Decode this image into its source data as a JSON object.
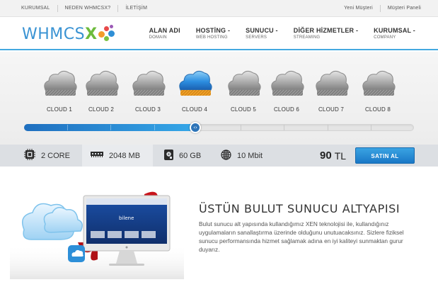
{
  "topbar": {
    "left_links": [
      "KURUMSAL",
      "NEDEN WHMCSX?",
      "İLETİŞİM"
    ],
    "right_links": [
      "Yeni Müşteri",
      "Müşteri Paneli"
    ]
  },
  "header": {
    "logo_text": "WHMCS",
    "logo_x": "X",
    "nav": [
      {
        "label": "ALAN ADI",
        "sub": "DOMAIN"
      },
      {
        "label": "HOSTİNG",
        "sub": "WEB HOSTING"
      },
      {
        "label": "SUNUCU",
        "sub": "SERVERS"
      },
      {
        "label": "DİĞER HİZMETLER",
        "sub": "STREAMING"
      },
      {
        "label": "KURUMSAL",
        "sub": "COMPANY"
      }
    ],
    "dropdown_marker": "-"
  },
  "plans": {
    "items": [
      "CLOUD 1",
      "CLOUD 2",
      "CLOUD 3",
      "CLOUD 4",
      "CLOUD 5",
      "CLOUD 6",
      "CLOUD 7",
      "CLOUD 8"
    ],
    "selected_index": 3,
    "slider_fraction": 0.44,
    "handle_glyph": "‹›"
  },
  "specs": {
    "cpu": "2 CORE",
    "ram": "2048 MB",
    "disk": "60 GB",
    "bandwidth": "10 Mbit",
    "price_value": "90",
    "price_currency": "TL",
    "buy_label": "SATIN AL"
  },
  "feature": {
    "title": "ÜSTÜN BULUT SUNUCU ALTYAPISI",
    "text": "Bulut sunucu alt yapısında kullandığımız XEN teknolojisi ile, kullandığınız uygulamaların sanallaştırma üzerinde olduğunu unutuacaksınız. Sizlere fiziksel sunucu performansında hizmet sağlamak adına en iyi kaliteyi sunmaktan gurur duyarız.",
    "screen_brand": "bilene"
  },
  "colors": {
    "accent": "#2d8fd8",
    "logo_blue": "#3a93d3",
    "logo_green": "#6dbb3c",
    "buy_button": "#2a8ad6",
    "slider_fill": "#35a7e8"
  },
  "icons": {
    "cpu": "cpu-chip-icon",
    "ram": "memory-icon",
    "disk": "hard-disk-icon",
    "bandwidth": "globe-icon",
    "slider": "slider-arrows-icon"
  }
}
